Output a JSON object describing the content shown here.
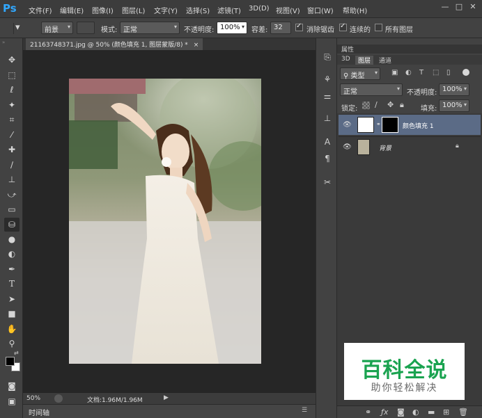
{
  "app": {
    "logo": "Ps",
    "menus": [
      "文件(F)",
      "编辑(E)",
      "图像(I)",
      "图层(L)",
      "文字(Y)",
      "选择(S)",
      "滤镜(T)",
      "3D(D)",
      "视图(V)",
      "窗口(W)",
      "帮助(H)"
    ],
    "window_buttons": [
      "—",
      "□",
      "✕"
    ]
  },
  "options": {
    "fill_source": "前景",
    "mode_label": "模式:",
    "mode_value": "正常",
    "opacity_label": "不透明度:",
    "opacity_value": "100%",
    "tolerance_label": "容差:",
    "tolerance_value": "32",
    "antialias_label": "消除锯齿",
    "antialias_checked": true,
    "contiguous_label": "连续的",
    "contiguous_checked": true,
    "all_layers_label": "所有图层",
    "all_layers_checked": false
  },
  "tools": [
    "move-icon",
    "marquee-icon",
    "lasso-icon",
    "magic-wand-icon",
    "crop-icon",
    "eyedropper-icon",
    "healing-icon",
    "brush-icon",
    "stamp-icon",
    "history-brush-icon",
    "eraser-icon",
    "paint-bucket-icon",
    "blur-icon",
    "dodge-icon",
    "pen-icon",
    "type-icon",
    "path-select-icon",
    "rectangle-icon",
    "hand-icon",
    "zoom-icon"
  ],
  "document": {
    "tab_title": "21163748371.jpg @ 50% (颜色填充 1, 图层蒙版/8) *",
    "tab_close": "×",
    "zoom": "50%",
    "doc_info": "文档:1.96M/1.96M",
    "timeline_label": "时间轴"
  },
  "panels": {
    "properties_tab": "属性",
    "tabs": [
      "3D",
      "图层",
      "通道"
    ],
    "filter_kind": "类型",
    "blend_mode": "正常",
    "opacity_label": "不透明度:",
    "opacity_value": "100%",
    "lock_label": "锁定:",
    "fill_label": "填充:",
    "fill_value": "100%",
    "layers": [
      {
        "name": "颜色填充 1",
        "selected": true
      },
      {
        "name": "背景",
        "selected": false
      }
    ]
  },
  "watermark": {
    "title": "百科全说",
    "subtitle": "助你轻松解决",
    "title_color": "#1aa350"
  }
}
